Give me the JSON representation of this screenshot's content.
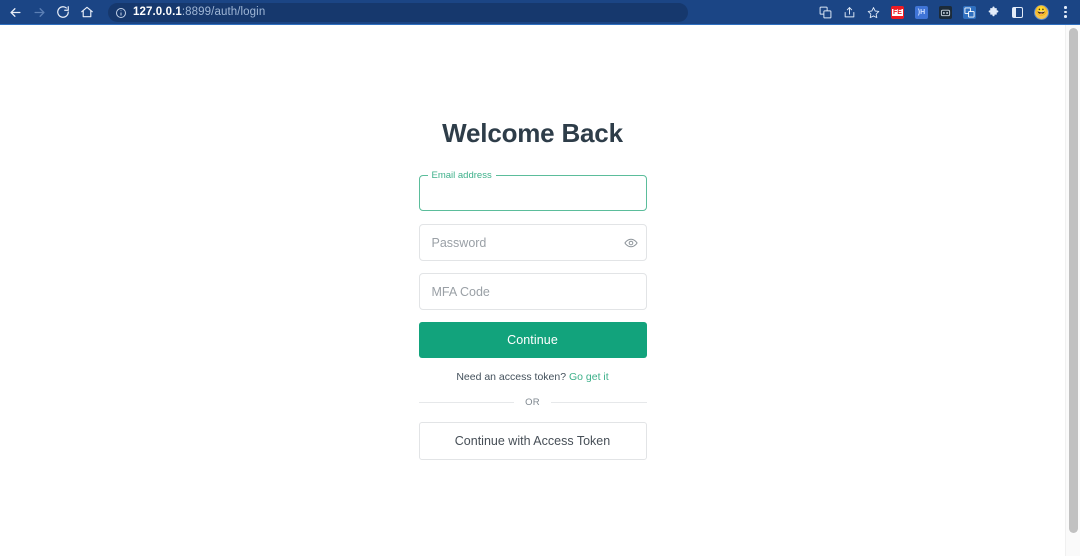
{
  "browser": {
    "nav": {
      "back_label": "Back",
      "forward_label": "Forward",
      "reload_label": "Reload",
      "home_label": "Home"
    },
    "omnibox": {
      "host": "127.0.0.1",
      "path": ":8899/auth/login",
      "full_url": "127.0.0.1:8899/auth/login",
      "info_icon": "info-circle-icon"
    },
    "toolbar_icons": [
      {
        "name": "translate-icon",
        "label": "Translate"
      },
      {
        "name": "share-icon",
        "label": "Share this page"
      },
      {
        "name": "bookmark-star-icon",
        "label": "Bookmark this tab"
      },
      {
        "name": "extension-fe-icon",
        "label": "FE"
      },
      {
        "name": "extension-jh-icon",
        "label": "JH"
      },
      {
        "name": "extension-robot-icon",
        "label": "Robot extension"
      },
      {
        "name": "extension-translate-icon",
        "label": "Translate extension"
      },
      {
        "name": "extensions-puzzle-icon",
        "label": "Extensions"
      },
      {
        "name": "side-panel-icon",
        "label": "Side panel"
      },
      {
        "name": "profile-avatar",
        "label": "Profile"
      },
      {
        "name": "browser-menu-icon",
        "label": "Customize and control"
      }
    ]
  },
  "page": {
    "title": "Welcome Back",
    "fields": {
      "email": {
        "label": "Email address",
        "value": "",
        "placeholder": ""
      },
      "password": {
        "placeholder": "Password",
        "value": "",
        "toggle_icon": "eye-icon"
      },
      "mfa": {
        "placeholder": "MFA Code",
        "value": ""
      }
    },
    "primary_button": "Continue",
    "helper": {
      "text": "Need an access token?",
      "link_text": "Go get it"
    },
    "divider_text": "OR",
    "secondary_button": "Continue with Access Token"
  },
  "colors": {
    "accent_green": "#12a37c",
    "link_green": "#3db08a",
    "field_border": "#e2e4e6",
    "title": "#2e3d49",
    "browser_bar": "#1b4585"
  }
}
